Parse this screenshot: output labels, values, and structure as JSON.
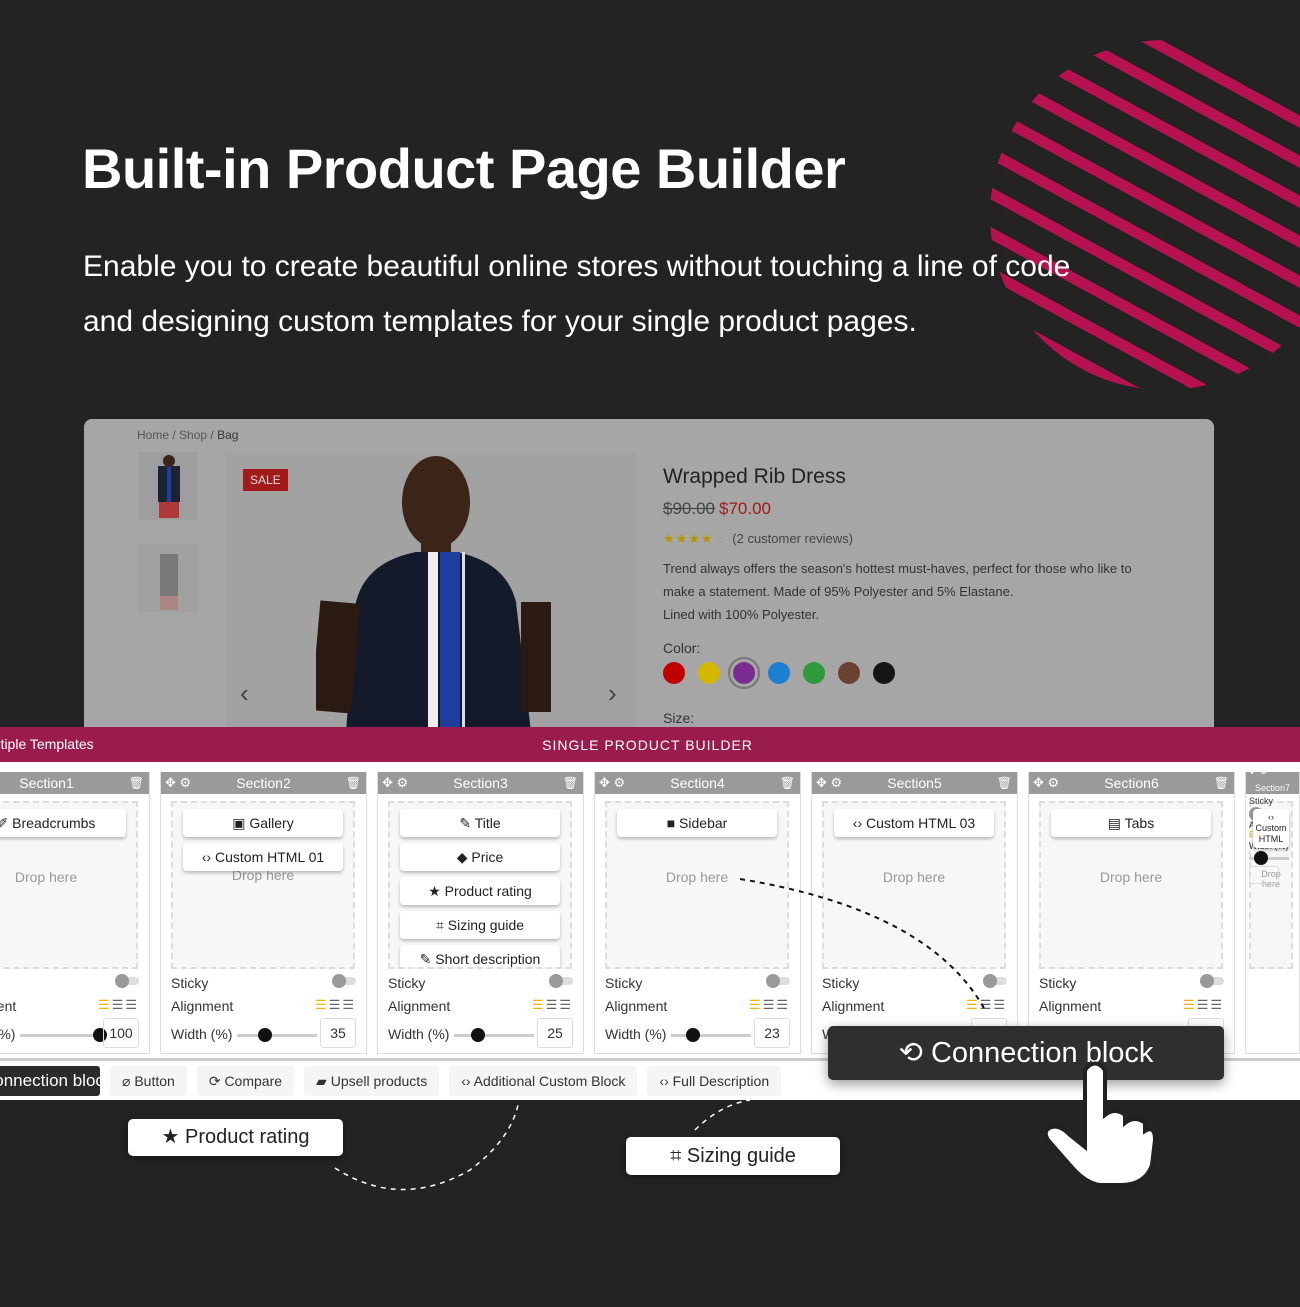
{
  "hero": {
    "title": "Built-in Product Page Builder",
    "subtitle_line1": "Enable you to create beautiful online stores without touching a line of code",
    "subtitle_line2": "and designing custom templates for your single product pages.",
    "accent_color": "#b5124f"
  },
  "product_page": {
    "breadcrumb": [
      "Home",
      "Shop",
      "Bag"
    ],
    "sale_badge": "SALE",
    "title": "Wrapped Rib Dress",
    "old_price": "$90.00",
    "new_price": "$70.00",
    "rating": 4,
    "reviews": "(2 customer reviews)",
    "description": [
      "Trend always offers the season's hottest must-haves, perfect for those who like to",
      "make a statement. Made of 95% Polyester and 5% Elastane.",
      "Lined with 100% Polyester."
    ],
    "color_label": "Color:",
    "colors": [
      "#c00000",
      "#d4b800",
      "#7b2a90",
      "#1e7fd0",
      "#2e9a3c",
      "#6b4232",
      "#151515"
    ],
    "selected_color": 2,
    "size_label": "Size:"
  },
  "builder": {
    "left_title": "Multiple Templates",
    "title": "SINGLE PRODUCT BUILDER",
    "bar_color": "#9a1c4c",
    "drop_text": "Drop here",
    "sticky_label": "Sticky",
    "alignment_label": "Alignment",
    "width_label": "Width (%)",
    "sections": [
      {
        "name": "Section1",
        "blocks": [
          "Breadcrumbs"
        ],
        "width": "100"
      },
      {
        "name": "Section2",
        "blocks": [
          "Gallery",
          "Custom HTML 01"
        ],
        "width": "35"
      },
      {
        "name": "Section3",
        "blocks": [
          "Title",
          "Price",
          "Product rating",
          "Sizing guide",
          "Short description"
        ],
        "width": "25"
      },
      {
        "name": "Section4",
        "blocks": [
          "Sidebar"
        ],
        "width": "23"
      },
      {
        "name": "Section5",
        "blocks": [
          "Custom HTML 03"
        ],
        "width": ""
      },
      {
        "name": "Section6",
        "blocks": [
          "Tabs"
        ],
        "width": ""
      },
      {
        "name": "Section7",
        "blocks": [
          "Custom HTML"
        ],
        "width": ""
      }
    ],
    "tools": [
      "Connection block",
      "Button",
      "Compare",
      "Upsell products",
      "Additional Custom Block",
      "Full Description"
    ]
  },
  "floating": {
    "product_rating": "Product rating",
    "sizing_guide": "Sizing guide",
    "connection_block": "Connection block"
  }
}
